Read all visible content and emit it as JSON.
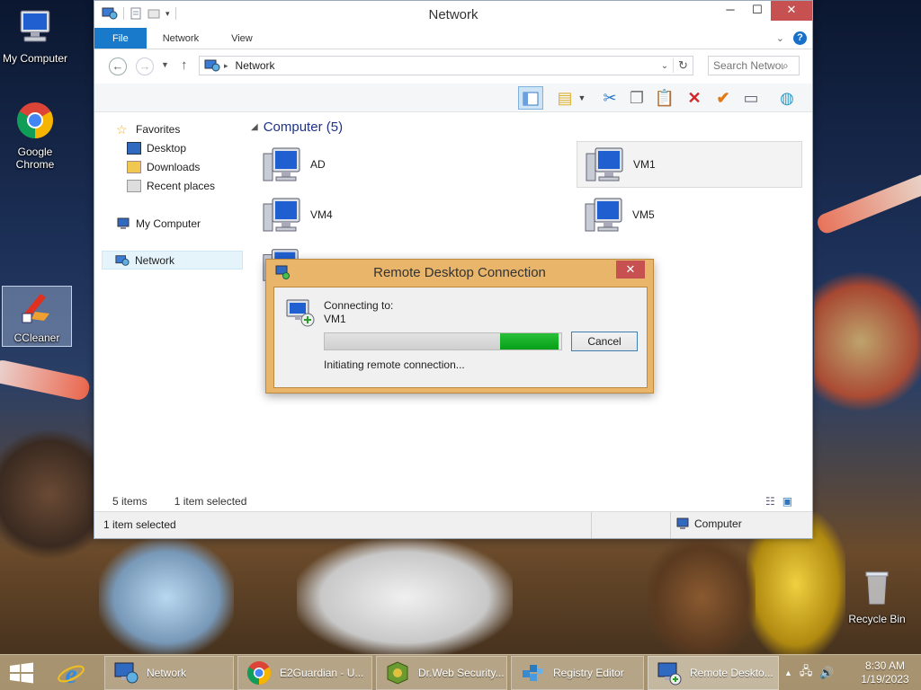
{
  "desktop": {
    "icons": [
      {
        "label": "My Computer"
      },
      {
        "label": "Google Chrome"
      },
      {
        "label": "CCleaner"
      },
      {
        "label": "Recycle Bin"
      }
    ]
  },
  "explorer": {
    "title": "Network",
    "ribbon_tabs": [
      "File",
      "Network",
      "View"
    ],
    "help_label": "?",
    "address": {
      "location": "Network"
    },
    "search": {
      "placeholder": "Search Network"
    },
    "nav": {
      "favorites": "Favorites",
      "desktop": "Desktop",
      "downloads": "Downloads",
      "recent": "Recent places",
      "my_computer": "My Computer",
      "network": "Network"
    },
    "group": {
      "label": "Computer (5)"
    },
    "computers": [
      {
        "name": "AD"
      },
      {
        "name": "VM1"
      },
      {
        "name": "VM4"
      },
      {
        "name": "VM5"
      }
    ],
    "status": {
      "items": "5 items",
      "selected": "1 item selected",
      "bottom_selected": "1 item selected",
      "bottom_zone": "Computer"
    }
  },
  "rdp_dialog": {
    "title": "Remote Desktop Connection",
    "connecting_label": "Connecting to:",
    "target": "VM1",
    "status": "Initiating remote connection...",
    "cancel_label": "Cancel",
    "progress_fraction": 0.74,
    "progress_chunk_fraction": 0.25
  },
  "taskbar": {
    "items": [
      {
        "label": "Network"
      },
      {
        "label": "E2Guardian - U..."
      },
      {
        "label": "Dr.Web Security..."
      },
      {
        "label": "Registry Editor"
      },
      {
        "label": "Remote Deskto..."
      }
    ],
    "clock": {
      "time": "8:30 AM",
      "date": "1/19/2023"
    }
  },
  "colors": {
    "file_tab": "#1979ca",
    "progress_green": "#06a018",
    "dialog_frame": "#e9b56a",
    "close_red": "#c75050"
  }
}
